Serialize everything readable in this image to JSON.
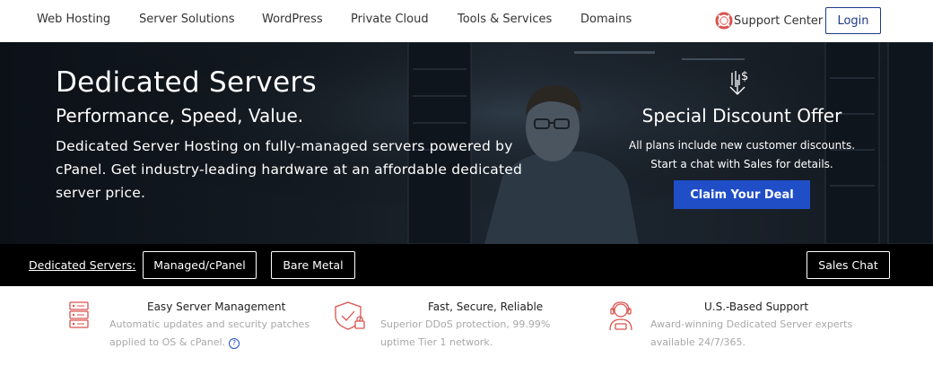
{
  "nav": {
    "items": [
      "Web Hosting",
      "Server Solutions",
      "WordPress",
      "Private Cloud",
      "Tools & Services",
      "Domains"
    ],
    "support_label": "Support Center",
    "login_label": "Login"
  },
  "hero": {
    "title": "Dedicated Servers",
    "subtitle": "Performance, Speed, Value.",
    "description": "Dedicated Server Hosting on fully-managed servers powered by cPanel. Get industry-leading hardware at an affordable dedicated server price."
  },
  "offer": {
    "icon": "discount-tag-icon",
    "title": "Special Discount Offer",
    "line1": "All plans include new customer discounts.",
    "line2": "Start a chat with Sales for details.",
    "button_label": "Claim Your Deal"
  },
  "subnav": {
    "label": "Dedicated Servers:",
    "buttons": [
      "Managed/cPanel",
      "Bare Metal"
    ],
    "chat_label": "Sales Chat"
  },
  "features": [
    {
      "icon": "server-stack-icon",
      "title": "Easy Server Management",
      "line1": "Automatic updates and security patches",
      "line2": "applied to OS & cPanel."
    },
    {
      "icon": "shield-lock-icon",
      "title": "Fast, Secure, Reliable",
      "line1": "Superior DDoS protection, 99.99%",
      "line2": "uptime Tier 1 network."
    },
    {
      "icon": "support-agent-icon",
      "title": "U.S.-Based Support",
      "line1": "Award-winning Dedicated Server experts",
      "line2": "available 24/7/365."
    }
  ],
  "colors": {
    "accent_blue": "#1f4ec7",
    "login_border": "#1b3a87",
    "icon_red": "#d9534f"
  }
}
